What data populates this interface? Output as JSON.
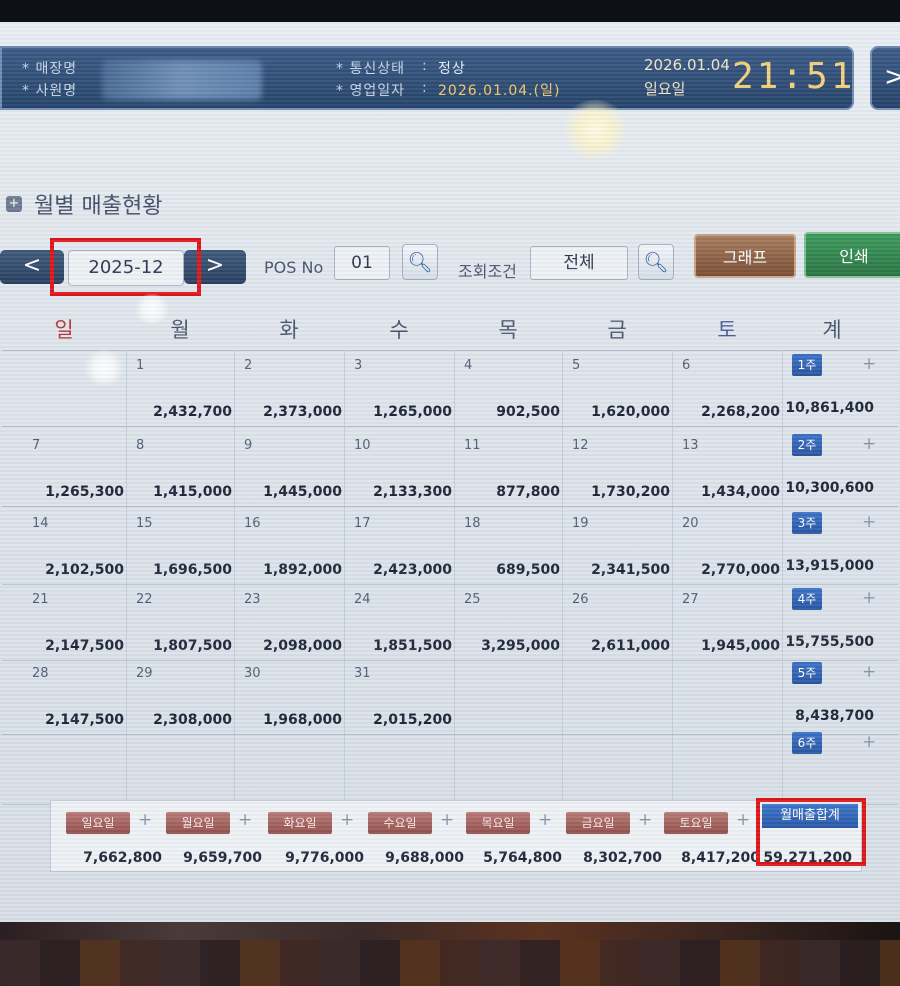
{
  "header": {
    "store_label": "* 매장명",
    "staff_label": "* 사원명",
    "comm_label": "* 통신상태",
    "comm_value": "정상",
    "bizdate_label": "* 영업일자",
    "bizdate_value": "2026.01.04.(일)",
    "colon": ":",
    "date": "2026.01.04",
    "weekday": "일요일",
    "clock": "21:51",
    "next_icon": ">"
  },
  "title": "월별 매출현황",
  "toolbar": {
    "prev_icon": "<",
    "next_icon": ">",
    "month": "2025-12",
    "pos_label": "POS No",
    "pos_value": "01",
    "cond_label": "조회조건",
    "cond_value": "전체",
    "search_icon": "magnifier-icon",
    "graph_label": "그래프",
    "print_label": "인쇄"
  },
  "day_headers": [
    "일",
    "월",
    "화",
    "수",
    "목",
    "금",
    "토",
    "계"
  ],
  "weeks": [
    {
      "days": [
        "",
        "1",
        "2",
        "3",
        "4",
        "5",
        "6"
      ],
      "amounts": [
        "",
        "2,432,700",
        "2,373,000",
        "1,265,000",
        "902,500",
        "1,620,000",
        "2,268,200"
      ],
      "week_label": "1주",
      "total": "10,861,400"
    },
    {
      "days": [
        "7",
        "8",
        "9",
        "10",
        "11",
        "12",
        "13"
      ],
      "amounts": [
        "1,265,300",
        "1,415,000",
        "1,445,000",
        "2,133,300",
        "877,800",
        "1,730,200",
        "1,434,000"
      ],
      "week_label": "2주",
      "total": "10,300,600"
    },
    {
      "days": [
        "14",
        "15",
        "16",
        "17",
        "18",
        "19",
        "20"
      ],
      "amounts": [
        "2,102,500",
        "1,696,500",
        "1,892,000",
        "2,423,000",
        "689,500",
        "2,341,500",
        "2,770,000"
      ],
      "week_label": "3주",
      "total": "13,915,000"
    },
    {
      "days": [
        "21",
        "22",
        "23",
        "24",
        "25",
        "26",
        "27"
      ],
      "amounts": [
        "2,147,500",
        "1,807,500",
        "2,098,000",
        "1,851,500",
        "3,295,000",
        "2,611,000",
        "1,945,000"
      ],
      "week_label": "4주",
      "total": "15,755,500"
    },
    {
      "days": [
        "28",
        "29",
        "30",
        "31",
        "",
        "",
        ""
      ],
      "amounts": [
        "2,147,500",
        "2,308,000",
        "1,968,000",
        "2,015,200",
        "",
        "",
        ""
      ],
      "week_label": "5주",
      "total": "8,438,700"
    },
    {
      "days": [
        "",
        "",
        "",
        "",
        "",
        "",
        ""
      ],
      "amounts": [
        "",
        "",
        "",
        "",
        "",
        "",
        ""
      ],
      "week_label": "6주",
      "total": ""
    }
  ],
  "plus": "+",
  "dow_totals": [
    {
      "label": "일요일",
      "value": "7,662,800"
    },
    {
      "label": "월요일",
      "value": "9,659,700"
    },
    {
      "label": "화요일",
      "value": "9,776,000"
    },
    {
      "label": "수요일",
      "value": "9,688,000"
    },
    {
      "label": "목요일",
      "value": "5,764,800"
    },
    {
      "label": "금요일",
      "value": "8,302,700"
    },
    {
      "label": "토요일",
      "value": "8,417,200"
    }
  ],
  "month_total": {
    "label": "월매출합계",
    "value": "59,271,200"
  },
  "colors": {
    "header": "#2f4f78",
    "week_button": "#2f62b6",
    "dow_button": "#a3625e",
    "highlight": "#e0161b"
  }
}
